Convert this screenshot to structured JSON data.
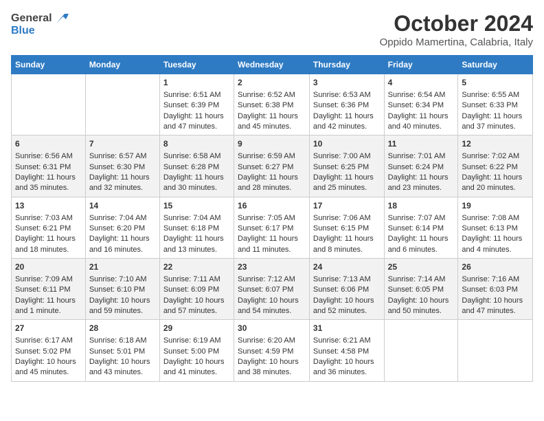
{
  "header": {
    "logo_line1": "General",
    "logo_line2": "Blue",
    "month": "October 2024",
    "location": "Oppido Mamertina, Calabria, Italy"
  },
  "days_of_week": [
    "Sunday",
    "Monday",
    "Tuesday",
    "Wednesday",
    "Thursday",
    "Friday",
    "Saturday"
  ],
  "weeks": [
    [
      {
        "day": "",
        "content": ""
      },
      {
        "day": "",
        "content": ""
      },
      {
        "day": "1",
        "content": "Sunrise: 6:51 AM\nSunset: 6:39 PM\nDaylight: 11 hours and 47 minutes."
      },
      {
        "day": "2",
        "content": "Sunrise: 6:52 AM\nSunset: 6:38 PM\nDaylight: 11 hours and 45 minutes."
      },
      {
        "day": "3",
        "content": "Sunrise: 6:53 AM\nSunset: 6:36 PM\nDaylight: 11 hours and 42 minutes."
      },
      {
        "day": "4",
        "content": "Sunrise: 6:54 AM\nSunset: 6:34 PM\nDaylight: 11 hours and 40 minutes."
      },
      {
        "day": "5",
        "content": "Sunrise: 6:55 AM\nSunset: 6:33 PM\nDaylight: 11 hours and 37 minutes."
      }
    ],
    [
      {
        "day": "6",
        "content": "Sunrise: 6:56 AM\nSunset: 6:31 PM\nDaylight: 11 hours and 35 minutes."
      },
      {
        "day": "7",
        "content": "Sunrise: 6:57 AM\nSunset: 6:30 PM\nDaylight: 11 hours and 32 minutes."
      },
      {
        "day": "8",
        "content": "Sunrise: 6:58 AM\nSunset: 6:28 PM\nDaylight: 11 hours and 30 minutes."
      },
      {
        "day": "9",
        "content": "Sunrise: 6:59 AM\nSunset: 6:27 PM\nDaylight: 11 hours and 28 minutes."
      },
      {
        "day": "10",
        "content": "Sunrise: 7:00 AM\nSunset: 6:25 PM\nDaylight: 11 hours and 25 minutes."
      },
      {
        "day": "11",
        "content": "Sunrise: 7:01 AM\nSunset: 6:24 PM\nDaylight: 11 hours and 23 minutes."
      },
      {
        "day": "12",
        "content": "Sunrise: 7:02 AM\nSunset: 6:22 PM\nDaylight: 11 hours and 20 minutes."
      }
    ],
    [
      {
        "day": "13",
        "content": "Sunrise: 7:03 AM\nSunset: 6:21 PM\nDaylight: 11 hours and 18 minutes."
      },
      {
        "day": "14",
        "content": "Sunrise: 7:04 AM\nSunset: 6:20 PM\nDaylight: 11 hours and 16 minutes."
      },
      {
        "day": "15",
        "content": "Sunrise: 7:04 AM\nSunset: 6:18 PM\nDaylight: 11 hours and 13 minutes."
      },
      {
        "day": "16",
        "content": "Sunrise: 7:05 AM\nSunset: 6:17 PM\nDaylight: 11 hours and 11 minutes."
      },
      {
        "day": "17",
        "content": "Sunrise: 7:06 AM\nSunset: 6:15 PM\nDaylight: 11 hours and 8 minutes."
      },
      {
        "day": "18",
        "content": "Sunrise: 7:07 AM\nSunset: 6:14 PM\nDaylight: 11 hours and 6 minutes."
      },
      {
        "day": "19",
        "content": "Sunrise: 7:08 AM\nSunset: 6:13 PM\nDaylight: 11 hours and 4 minutes."
      }
    ],
    [
      {
        "day": "20",
        "content": "Sunrise: 7:09 AM\nSunset: 6:11 PM\nDaylight: 11 hours and 1 minute."
      },
      {
        "day": "21",
        "content": "Sunrise: 7:10 AM\nSunset: 6:10 PM\nDaylight: 10 hours and 59 minutes."
      },
      {
        "day": "22",
        "content": "Sunrise: 7:11 AM\nSunset: 6:09 PM\nDaylight: 10 hours and 57 minutes."
      },
      {
        "day": "23",
        "content": "Sunrise: 7:12 AM\nSunset: 6:07 PM\nDaylight: 10 hours and 54 minutes."
      },
      {
        "day": "24",
        "content": "Sunrise: 7:13 AM\nSunset: 6:06 PM\nDaylight: 10 hours and 52 minutes."
      },
      {
        "day": "25",
        "content": "Sunrise: 7:14 AM\nSunset: 6:05 PM\nDaylight: 10 hours and 50 minutes."
      },
      {
        "day": "26",
        "content": "Sunrise: 7:16 AM\nSunset: 6:03 PM\nDaylight: 10 hours and 47 minutes."
      }
    ],
    [
      {
        "day": "27",
        "content": "Sunrise: 6:17 AM\nSunset: 5:02 PM\nDaylight: 10 hours and 45 minutes."
      },
      {
        "day": "28",
        "content": "Sunrise: 6:18 AM\nSunset: 5:01 PM\nDaylight: 10 hours and 43 minutes."
      },
      {
        "day": "29",
        "content": "Sunrise: 6:19 AM\nSunset: 5:00 PM\nDaylight: 10 hours and 41 minutes."
      },
      {
        "day": "30",
        "content": "Sunrise: 6:20 AM\nSunset: 4:59 PM\nDaylight: 10 hours and 38 minutes."
      },
      {
        "day": "31",
        "content": "Sunrise: 6:21 AM\nSunset: 4:58 PM\nDaylight: 10 hours and 36 minutes."
      },
      {
        "day": "",
        "content": ""
      },
      {
        "day": "",
        "content": ""
      }
    ]
  ]
}
